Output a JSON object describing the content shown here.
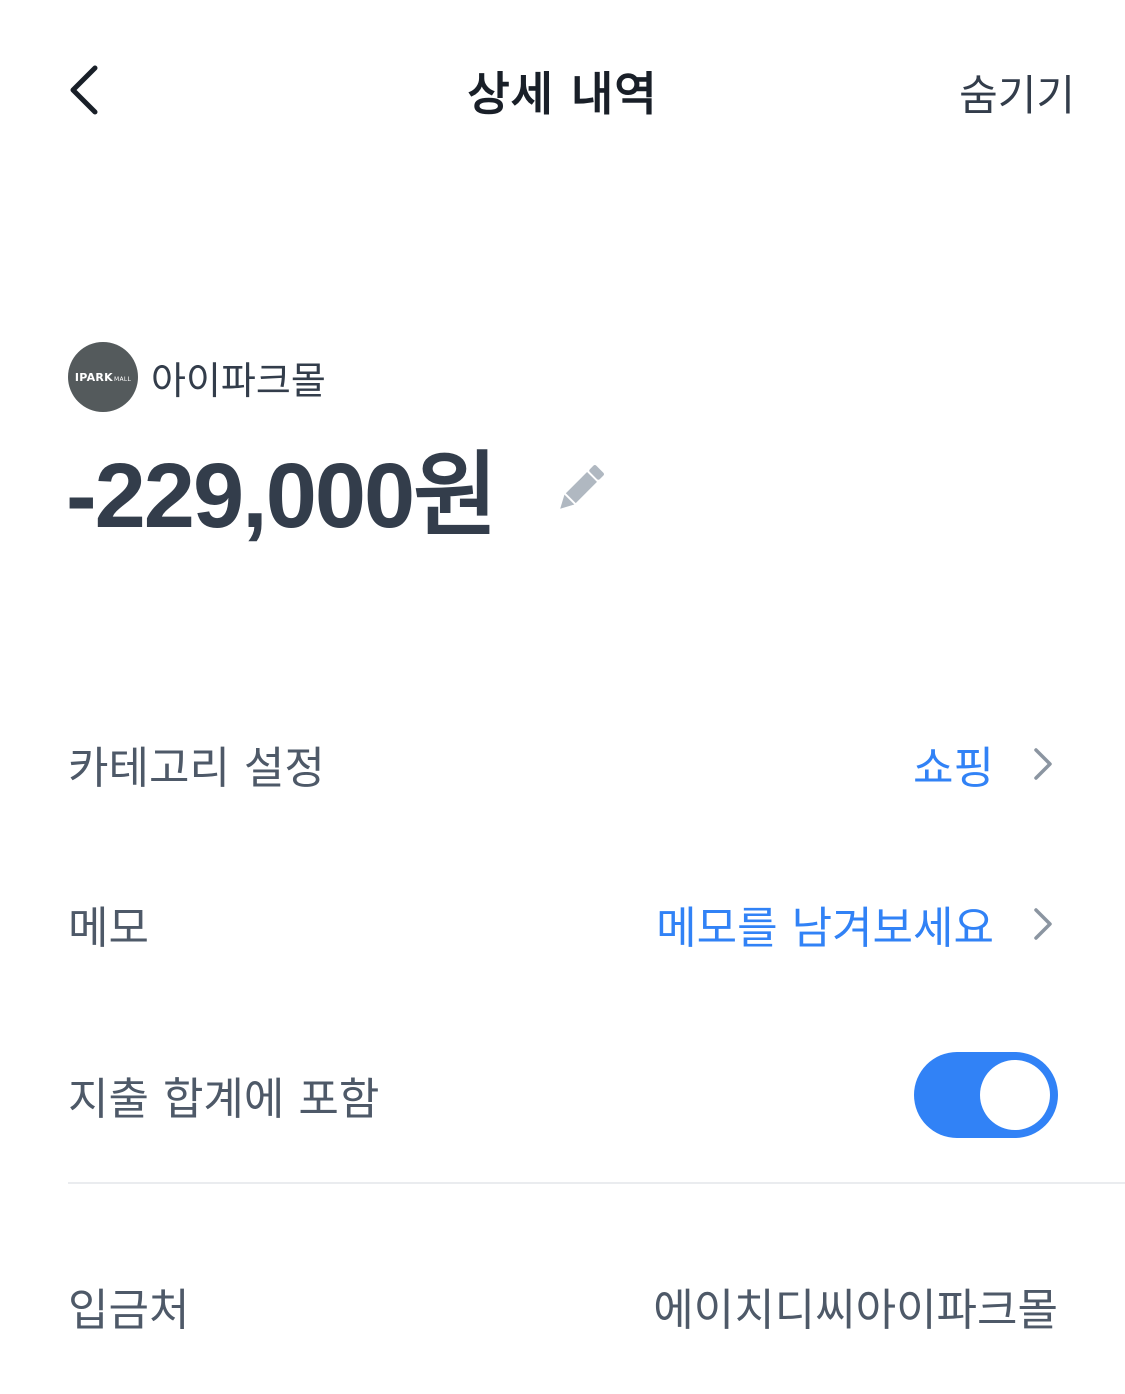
{
  "header": {
    "title": "상세 내역",
    "hide_label": "숨기기",
    "back_icon": "chevron-left-icon"
  },
  "merchant": {
    "logo_text": "IPARK",
    "logo_subtext": "MALL",
    "name": "아이파크몰"
  },
  "transaction": {
    "amount": "-229,000원",
    "edit_icon": "pencil-icon"
  },
  "rows": {
    "category": {
      "label": "카테고리 설정",
      "value": "쇼핑"
    },
    "memo": {
      "label": "메모",
      "value": "메모를 남겨보세요"
    },
    "include_total": {
      "label": "지출 합계에 포함",
      "toggle_on": true
    },
    "depositor": {
      "label": "입금처",
      "value": "에이치디씨아이파크몰"
    }
  },
  "colors": {
    "accent": "#3182f6",
    "text_primary": "#333d4b",
    "text_secondary": "#4e5968",
    "logo_bg": "#545a5c",
    "divider": "#eaecef"
  }
}
